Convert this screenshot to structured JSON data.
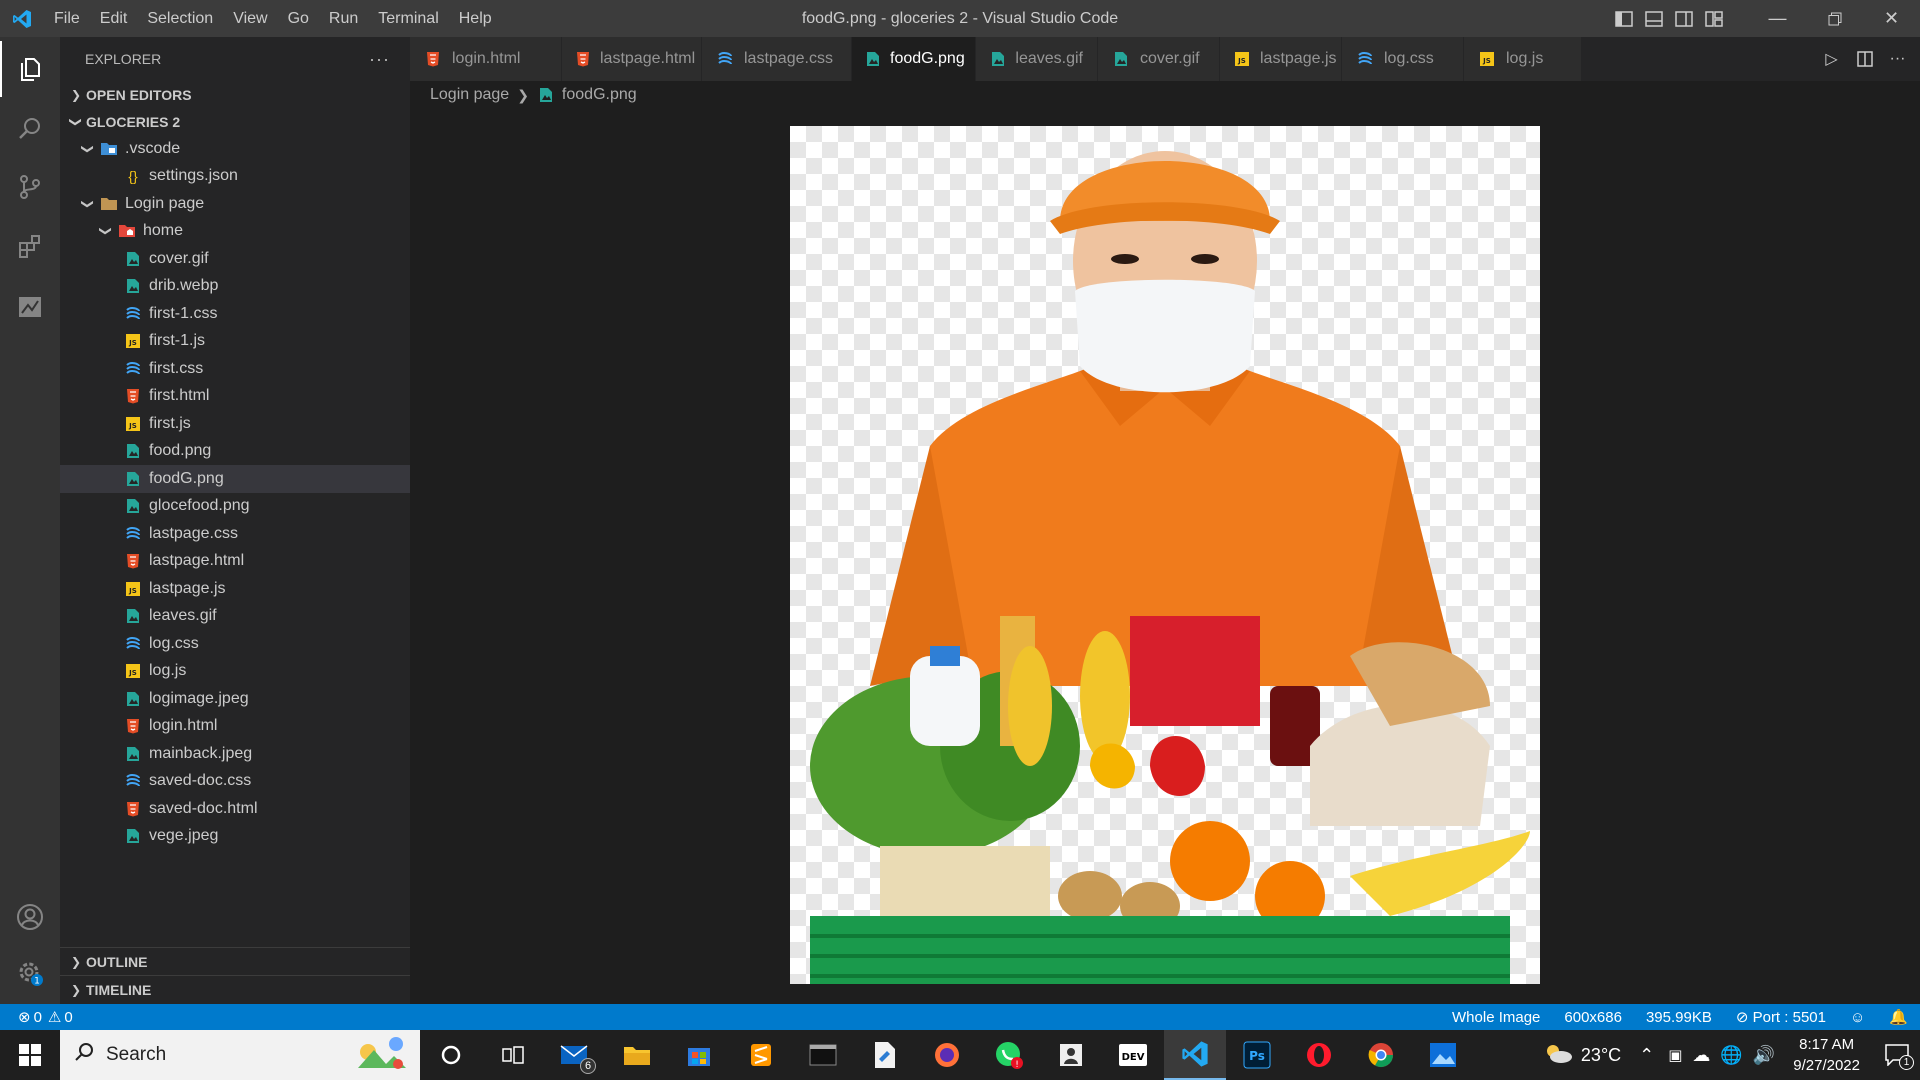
{
  "window": {
    "title": "foodG.png - gloceries 2 - Visual Studio Code",
    "menu": [
      "File",
      "Edit",
      "Selection",
      "View",
      "Go",
      "Run",
      "Terminal",
      "Help"
    ]
  },
  "sidebar": {
    "header": "EXPLORER",
    "open_editors": "OPEN EDITORS",
    "workspace": "GLOCERIES 2",
    "tree": [
      {
        "label": ".vscode",
        "kind": "folder-vscode",
        "expanded": true,
        "depth": 1
      },
      {
        "label": "settings.json",
        "kind": "json",
        "depth": 2
      },
      {
        "label": "Login page",
        "kind": "folder",
        "expanded": true,
        "depth": 1
      },
      {
        "label": "home",
        "kind": "folder-home",
        "expanded": true,
        "depth": 2
      },
      {
        "label": "cover.gif",
        "kind": "image",
        "depth": 2
      },
      {
        "label": "drib.webp",
        "kind": "image",
        "depth": 2
      },
      {
        "label": "first-1.css",
        "kind": "css",
        "depth": 2
      },
      {
        "label": "first-1.js",
        "kind": "js",
        "depth": 2
      },
      {
        "label": "first.css",
        "kind": "css",
        "depth": 2
      },
      {
        "label": "first.html",
        "kind": "html",
        "depth": 2
      },
      {
        "label": "first.js",
        "kind": "js",
        "depth": 2
      },
      {
        "label": "food.png",
        "kind": "image",
        "depth": 2
      },
      {
        "label": "foodG.png",
        "kind": "image",
        "depth": 2,
        "selected": true
      },
      {
        "label": "glocefood.png",
        "kind": "image",
        "depth": 2
      },
      {
        "label": "lastpage.css",
        "kind": "css",
        "depth": 2
      },
      {
        "label": "lastpage.html",
        "kind": "html",
        "depth": 2
      },
      {
        "label": "lastpage.js",
        "kind": "js",
        "depth": 2
      },
      {
        "label": "leaves.gif",
        "kind": "image",
        "depth": 2
      },
      {
        "label": "log.css",
        "kind": "css",
        "depth": 2
      },
      {
        "label": "log.js",
        "kind": "js",
        "depth": 2
      },
      {
        "label": "logimage.jpeg",
        "kind": "image",
        "depth": 2
      },
      {
        "label": "login.html",
        "kind": "html",
        "depth": 2
      },
      {
        "label": "mainback.jpeg",
        "kind": "image",
        "depth": 2
      },
      {
        "label": "saved-doc.css",
        "kind": "css",
        "depth": 2
      },
      {
        "label": "saved-doc.html",
        "kind": "html",
        "depth": 2
      },
      {
        "label": "vege.jpeg",
        "kind": "image",
        "depth": 2
      }
    ],
    "outline": "OUTLINE",
    "timeline": "TIMELINE"
  },
  "tabs": [
    {
      "label": "login.html",
      "kind": "html"
    },
    {
      "label": "lastpage.html",
      "kind": "html"
    },
    {
      "label": "lastpage.css",
      "kind": "css"
    },
    {
      "label": "foodG.png",
      "kind": "image",
      "active": true
    },
    {
      "label": "leaves.gif",
      "kind": "image"
    },
    {
      "label": "cover.gif",
      "kind": "image"
    },
    {
      "label": "lastpage.js",
      "kind": "js"
    },
    {
      "label": "log.css",
      "kind": "css"
    },
    {
      "label": "log.js",
      "kind": "js"
    }
  ],
  "breadcrumb": {
    "folder": "Login page",
    "file": "foodG.png"
  },
  "statusbar": {
    "errors": "0",
    "warnings": "0",
    "zoom": "Whole Image",
    "dimensions": "600x686",
    "size": "395.99KB",
    "port": "Port : 5501"
  },
  "taskbar": {
    "search": "Search",
    "mail_badge": "6",
    "temperature": "23°C",
    "time": "8:17 AM",
    "date": "9/27/2022",
    "notif_badge": "1"
  },
  "colors": {
    "accent": "#007acc",
    "html_icon": "#e44d26",
    "css_icon": "#42a5f5",
    "js_icon": "#f5c518",
    "image_icon": "#26a69a"
  }
}
